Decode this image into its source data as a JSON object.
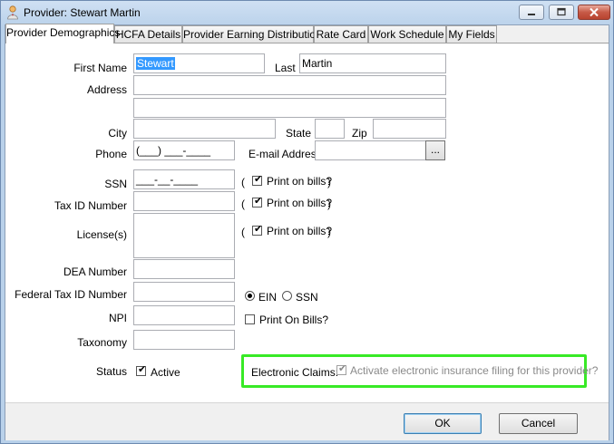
{
  "window": {
    "title": "Provider: Stewart Martin",
    "minimize_label": "",
    "maximize_label": "",
    "close_label": ""
  },
  "tabs": [
    {
      "label": "Provider Demographics"
    },
    {
      "label": "HCFA Details"
    },
    {
      "label": "Provider Earning Distribution"
    },
    {
      "label": "Rate Card"
    },
    {
      "label": "Work Schedule"
    },
    {
      "label": "My Fields"
    }
  ],
  "form": {
    "first_name_label": "First Name",
    "first_name_value": "Stewart",
    "last_label": "Last",
    "last_value": "Martin",
    "address_label": "Address",
    "address1_value": "",
    "address2_value": "",
    "city_label": "City",
    "city_value": "",
    "state_label": "State",
    "state_value": "",
    "zip_label": "Zip",
    "zip_value": "",
    "phone_label": "Phone",
    "phone_mask": "(___) ___-____",
    "email_label": "E-mail Address",
    "email_value": "",
    "email_browse_label": "...",
    "ssn_label": "SSN",
    "ssn_mask": "___-__-____",
    "tax_id_label": "Tax ID Number",
    "tax_id_value": "",
    "license_label": "License(s)",
    "license_value": "",
    "print_on_bills_label": "Print on bills?",
    "paren_open": "(",
    "paren_close": ")",
    "dea_label": "DEA Number",
    "dea_value": "",
    "federal_tax_label": "Federal Tax ID Number",
    "federal_tax_value": "",
    "ein_label": "EIN",
    "ssn_radio_label": "SSN",
    "npi_label": "NPI",
    "npi_value": "",
    "print_on_bills_npi_label": "Print On Bills?",
    "taxonomy_label": "Taxonomy",
    "taxonomy_value": "",
    "status_label": "Status",
    "active_label": "Active",
    "electronic_claims_label": "Electronic Claims:",
    "electronic_claims_checkbox_label": "Activate electronic insurance filing for this provider?"
  },
  "buttons": {
    "ok": "OK",
    "cancel": "Cancel"
  },
  "state": {
    "ssn_print_checked": true,
    "tax_id_print_checked": true,
    "license_print_checked": true,
    "federal_tax_type": "EIN",
    "npi_print_checked": false,
    "active_checked": true,
    "electronic_claims_checked": true,
    "electronic_claims_enabled": false
  },
  "colors": {
    "highlight_box": "#38ea26",
    "selection": "#3399ff"
  }
}
